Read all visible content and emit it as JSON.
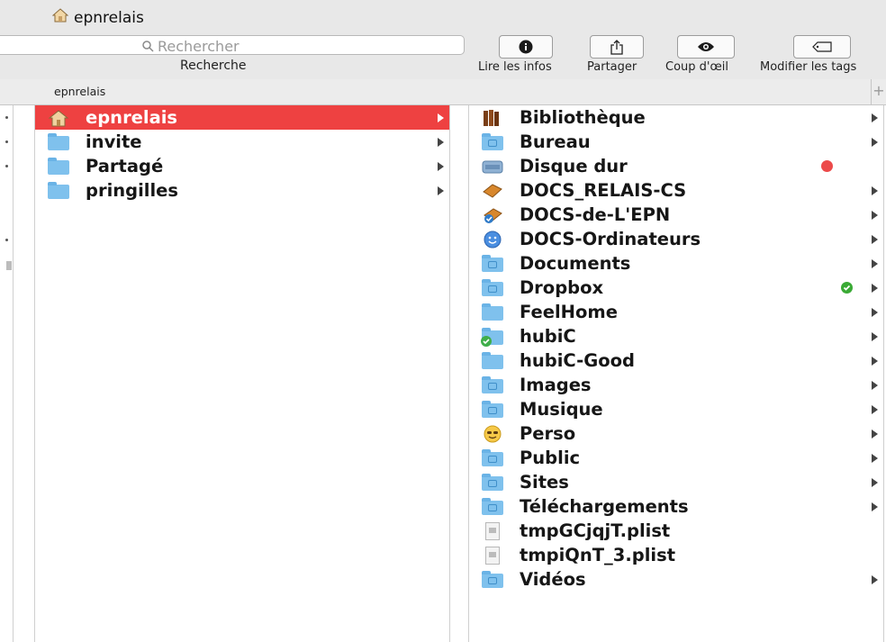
{
  "window": {
    "title": "epnrelais",
    "title_icon": "home-icon"
  },
  "toolbar": {
    "search_placeholder": "Rechercher",
    "search_label": "Recherche",
    "buttons": [
      {
        "label": "Lire les infos",
        "icon": "info-icon"
      },
      {
        "label": "Partager",
        "icon": "share-icon"
      },
      {
        "label": "Coup d'œil",
        "icon": "eye-icon"
      },
      {
        "label": "Modifier les tags",
        "icon": "tag-icon"
      }
    ]
  },
  "pathbar": {
    "crumb": "epnrelais",
    "add_label": "+"
  },
  "column1": [
    {
      "name": "epnrelais",
      "icon": "home-folder-icon",
      "selected": true,
      "arrow": true
    },
    {
      "name": "invite",
      "icon": "folder-icon",
      "arrow": true
    },
    {
      "name": "Partagé",
      "icon": "folder-icon",
      "arrow": true
    },
    {
      "name": "pringilles",
      "icon": "folder-icon",
      "arrow": true
    }
  ],
  "column2": [
    {
      "name": "Bibliothèque",
      "icon": "books-icon",
      "arrow": true
    },
    {
      "name": "Bureau",
      "icon": "desktop-folder-icon",
      "arrow": true
    },
    {
      "name": "Disque dur",
      "icon": "hard-drive-icon",
      "arrow": false,
      "tag": "red",
      "tag_color": "#ec4a4a"
    },
    {
      "name": "DOCS_RELAIS-CS",
      "icon": "book-icon",
      "arrow": true
    },
    {
      "name": "DOCS-de-L'EPN",
      "icon": "book-check-icon",
      "arrow": true
    },
    {
      "name": "DOCS-Ordinateurs",
      "icon": "smiley-blue-icon",
      "arrow": true
    },
    {
      "name": "Documents",
      "icon": "documents-folder-icon",
      "arrow": true
    },
    {
      "name": "Dropbox",
      "icon": "dropbox-folder-icon",
      "arrow": true,
      "tag": "green-check",
      "tag_color": "#3aaa35"
    },
    {
      "name": "FeelHome",
      "icon": "folder-icon",
      "arrow": true
    },
    {
      "name": "hubiC",
      "icon": "synced-folder-icon",
      "arrow": true
    },
    {
      "name": "hubiC-Good",
      "icon": "folder-icon",
      "arrow": true
    },
    {
      "name": "Images",
      "icon": "pictures-folder-icon",
      "arrow": true
    },
    {
      "name": "Musique",
      "icon": "music-folder-icon",
      "arrow": true
    },
    {
      "name": "Perso",
      "icon": "smiley-emoji-icon",
      "arrow": true
    },
    {
      "name": "Public",
      "icon": "public-folder-icon",
      "arrow": true
    },
    {
      "name": "Sites",
      "icon": "sites-folder-icon",
      "arrow": true
    },
    {
      "name": "Téléchargements",
      "icon": "downloads-folder-icon",
      "arrow": true
    },
    {
      "name": "tmpGCjqjT.plist",
      "icon": "plist-file-icon",
      "arrow": false
    },
    {
      "name": "tmpiQnT_3.plist",
      "icon": "plist-file-icon",
      "arrow": false
    },
    {
      "name": "Vidéos",
      "icon": "movies-folder-icon",
      "arrow": true
    }
  ],
  "colors": {
    "selection": "#ee4141",
    "folder": "#7fc1ed",
    "chrome": "#e8e8e8"
  }
}
